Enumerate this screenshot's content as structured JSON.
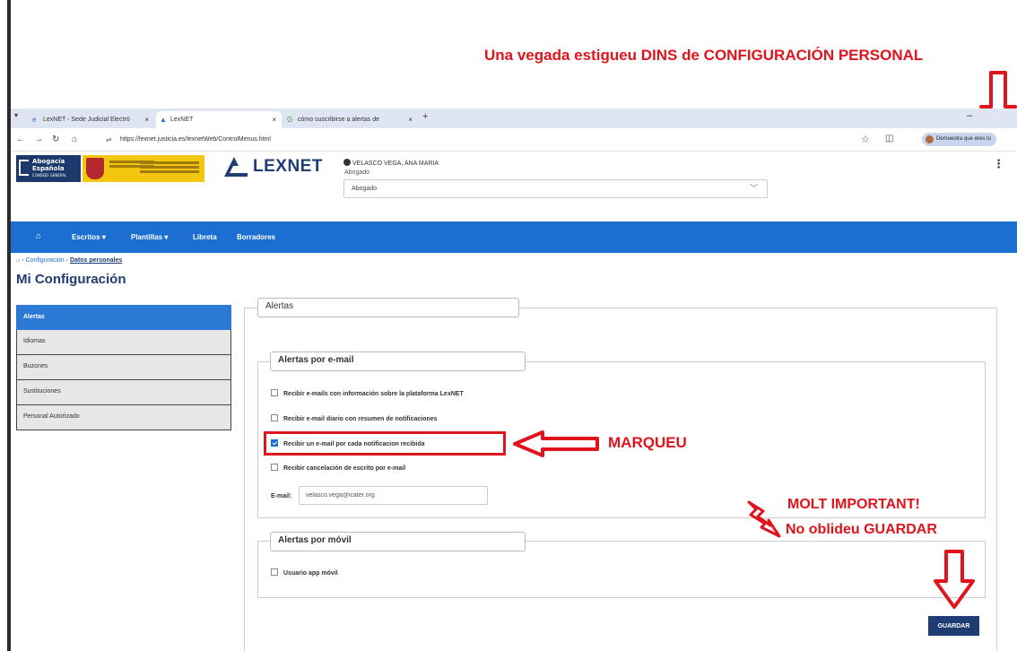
{
  "annotations": {
    "top": "Una vegada estigueu DINS de CONFIGURACIÓN PERSONAL",
    "marqueu": "MARQUEU",
    "important_1": "MOLT IMPORTANT!",
    "important_2": "No oblideu GUARDAR",
    "color": "#e0141c"
  },
  "browser": {
    "tabs": [
      {
        "label": "LexNET - Sede Judicial Electró"
      },
      {
        "label": "LexNET"
      },
      {
        "label": "cómo suscribirse a alertas de"
      }
    ],
    "tab_close": "×",
    "new_tab": "+",
    "url": "https://lexnet.justicia.es/lexnetWeb/ControlMenus.html",
    "profile_label": "Demuestra que eres tú"
  },
  "header": {
    "abogacia_line1": "Abogacía",
    "abogacia_line2": "Española",
    "abogacia_sub": "CONSEJO GENERAL",
    "brand": "LEXNET",
    "user": "VELASCO VEGA, ANA MARIA",
    "role_label": "Abogado",
    "role_selected": "Abogado"
  },
  "nav": {
    "items": [
      "Escritos",
      "Plantillas",
      "Libreta",
      "Borradores"
    ],
    "dropdown_marker": "▾",
    "color": "#1c6fd1"
  },
  "breadcrumb": {
    "level1": "Configuración",
    "level2": "Datos personales",
    "sep": "›"
  },
  "page_title": "Mi Configuración",
  "sidebar": {
    "items": [
      "Alertas",
      "Idiomas",
      "Buzones",
      "Sustituciones",
      "Personal Autorizado"
    ],
    "active": "Alertas"
  },
  "alerts": {
    "section_title": "Alertas",
    "email_group_title": "Alertas por e-mail",
    "options": [
      {
        "label": "Recibir e-mails con información sobre la plataforma LexNET",
        "checked": false
      },
      {
        "label": "Recibir e-mail diario con resumen de notificaciones",
        "checked": false
      },
      {
        "label": "Recibir un e-mail por cada notificacion recibida",
        "checked": true
      },
      {
        "label": "Recibir cancelación de escrito por e-mail",
        "checked": false
      }
    ],
    "email_label": "E-mail:",
    "email_value": "velasco.vega@icater.org",
    "mobile_group_title": "Alertas por móvil",
    "mobile_option": "Usuario app móvil",
    "save_button": "GUARDAR"
  }
}
